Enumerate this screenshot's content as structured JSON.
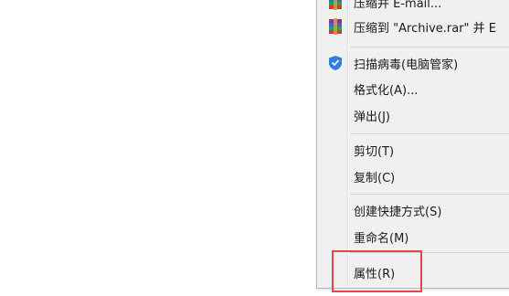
{
  "context_menu": {
    "items": [
      {
        "label": "压缩并 E-mail...",
        "icon": "winrar-archive-icon"
      },
      {
        "label": "压缩到 \"Archive.rar\" 并 E",
        "icon": "winrar-archive-icon"
      },
      {
        "label": "扫描病毒(电脑管家)",
        "icon": "shield-icon"
      },
      {
        "label": "格式化(A)..."
      },
      {
        "label": "弹出(J)"
      },
      {
        "label": "剪切(T)"
      },
      {
        "label": "复制(C)"
      },
      {
        "label": "创建快捷方式(S)"
      },
      {
        "label": "重命名(M)"
      },
      {
        "label": "属性(R)"
      }
    ]
  },
  "highlight_color": "#e0484a"
}
